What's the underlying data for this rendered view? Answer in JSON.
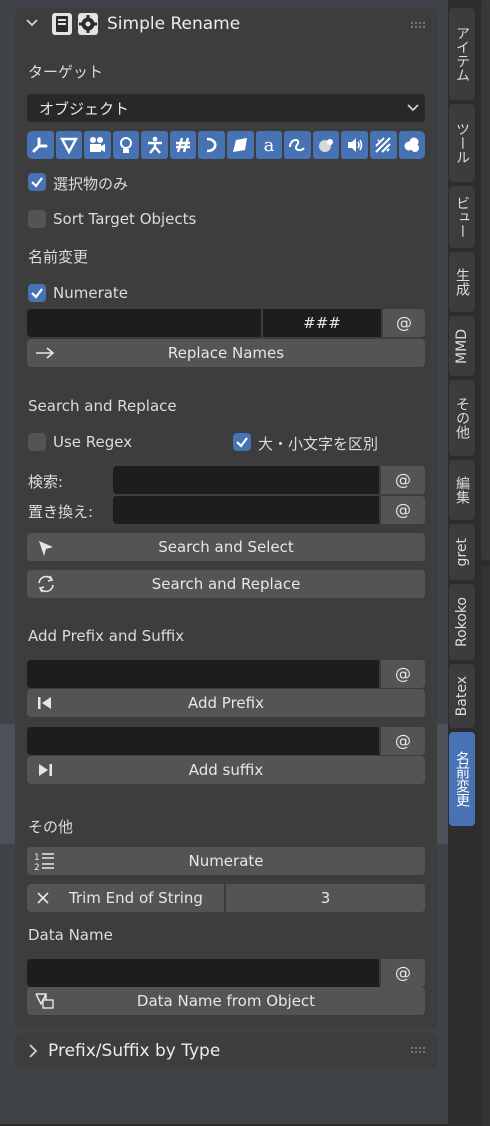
{
  "panel": {
    "title": "Simple Rename",
    "target_label": "ターゲット",
    "target_value": "オブジェクト",
    "selected_only": "選択物のみ",
    "sort_target": "Sort Target Objects",
    "rename_section": "名前変更",
    "numerate_check": "Numerate",
    "numerate_pattern": "###",
    "at_symbol": "@",
    "replace_names": "Replace Names",
    "search_replace_section": "Search and Replace",
    "use_regex": "Use Regex",
    "case_sensitive": "大・小文字を区別",
    "search_label": "検索:",
    "replace_label": "置き換え:",
    "search_select_button": "Search and Select",
    "search_replace_button": "Search and Replace",
    "prefix_suffix_section": "Add Prefix and Suffix",
    "add_prefix_button": "Add Prefix",
    "add_suffix_button": "Add suffix",
    "other_section": "その他",
    "numerate_button": "Numerate",
    "trim_button": "Trim End of String",
    "trim_value": "3",
    "data_name_section": "Data Name",
    "data_name_button": "Data Name from Object"
  },
  "panel2": {
    "title": "Prefix/Suffix by Type"
  },
  "sidebar_tabs": [
    "アイテム",
    "ツール",
    "ビュー",
    "生成",
    "MMD",
    "その他",
    "編集",
    "gret",
    "Rokoko",
    "Batex",
    "名前変更"
  ],
  "target_icons": [
    "bone-icon",
    "mesh-icon",
    "camera-icon",
    "light-icon",
    "armature-icon",
    "grease-pencil-icon",
    "curve-icon",
    "surface-icon",
    "text-icon",
    "curves-icon",
    "meta-icon",
    "speaker-icon",
    "force-field-icon",
    "volume-icon"
  ],
  "colors": {
    "accent": "#4772b3",
    "panel": "#3d3d3d",
    "field": "#1d1d1d",
    "button": "#545454"
  }
}
